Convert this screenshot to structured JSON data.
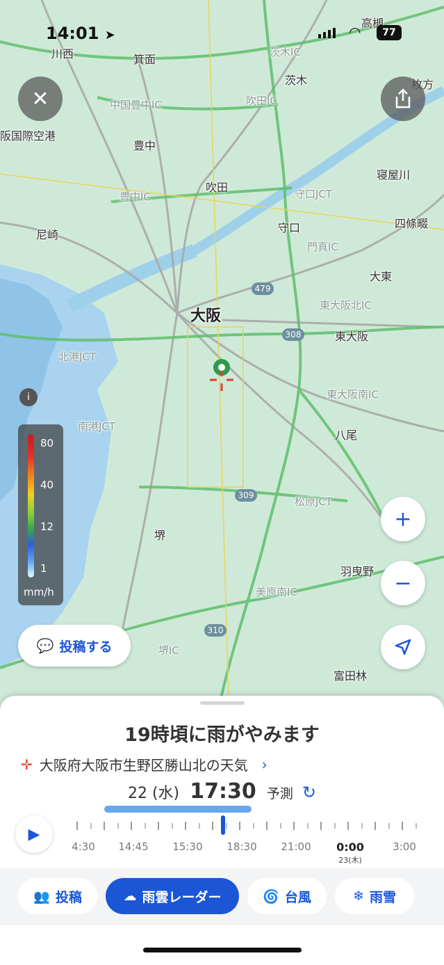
{
  "status_bar": {
    "time": "14:01",
    "battery": "77"
  },
  "map": {
    "labels": [
      {
        "text": "高槻",
        "kind": "city"
      },
      {
        "text": "川西",
        "kind": "city"
      },
      {
        "text": "箕面",
        "kind": "city"
      },
      {
        "text": "茨木IC",
        "kind": "ic"
      },
      {
        "text": "茨木",
        "kind": "city"
      },
      {
        "text": "枚方",
        "kind": "city"
      },
      {
        "text": "中国豊中IC",
        "kind": "ic"
      },
      {
        "text": "吹田IC",
        "kind": "ic"
      },
      {
        "text": "阪国際空港",
        "kind": "city"
      },
      {
        "text": "豊中",
        "kind": "city"
      },
      {
        "text": "寝屋川",
        "kind": "city"
      },
      {
        "text": "豊中IC",
        "kind": "ic"
      },
      {
        "text": "吹田",
        "kind": "city"
      },
      {
        "text": "守口JCT",
        "kind": "ic"
      },
      {
        "text": "尼崎",
        "kind": "city"
      },
      {
        "text": "守口",
        "kind": "city"
      },
      {
        "text": "四條畷",
        "kind": "city"
      },
      {
        "text": "門真IC",
        "kind": "ic"
      },
      {
        "text": "大東",
        "kind": "city"
      },
      {
        "text": "東大阪北IC",
        "kind": "ic"
      },
      {
        "text": "大阪",
        "kind": "big"
      },
      {
        "text": "東大阪",
        "kind": "city"
      },
      {
        "text": "北港JCT",
        "kind": "ic"
      },
      {
        "text": "東大阪南IC",
        "kind": "ic"
      },
      {
        "text": "南港JCT",
        "kind": "ic"
      },
      {
        "text": "八尾",
        "kind": "city"
      },
      {
        "text": "松原JCT",
        "kind": "ic"
      },
      {
        "text": "堺",
        "kind": "city"
      },
      {
        "text": "羽曳野",
        "kind": "city"
      },
      {
        "text": "美原南IC",
        "kind": "ic"
      },
      {
        "text": "堺IC",
        "kind": "ic"
      },
      {
        "text": "富田林",
        "kind": "city"
      }
    ],
    "route_shields": [
      "479",
      "308",
      "309",
      "310"
    ],
    "legend": {
      "values": [
        "80",
        "40",
        "12",
        "1"
      ],
      "unit": "mm/h"
    },
    "post_button": "投稿する"
  },
  "sheet": {
    "headline": "19時頃に雨がやみます",
    "place": "大阪府大阪市生野区勝山北の天気",
    "date": "22 (水)",
    "time": "17:30",
    "mode": "予測",
    "timeline": {
      "labels": [
        "4:30",
        "14:45",
        "15:30",
        "18:30",
        "21:00",
        "0:00",
        "3:00"
      ],
      "next_day": "23(木)",
      "progress": 0.42
    },
    "tabs": [
      {
        "label": "投稿",
        "icon": "people-icon",
        "active": false
      },
      {
        "label": "雨雲レーダー",
        "icon": "rain-cloud-icon",
        "active": true
      },
      {
        "label": "台風",
        "icon": "typhoon-icon",
        "active": false
      },
      {
        "label": "雨雪",
        "icon": "snow-icon",
        "active": false
      }
    ]
  },
  "colors": {
    "accent": "#1a56d6",
    "map_land": "#cfe9d9",
    "map_water": "#a9d3ee"
  }
}
